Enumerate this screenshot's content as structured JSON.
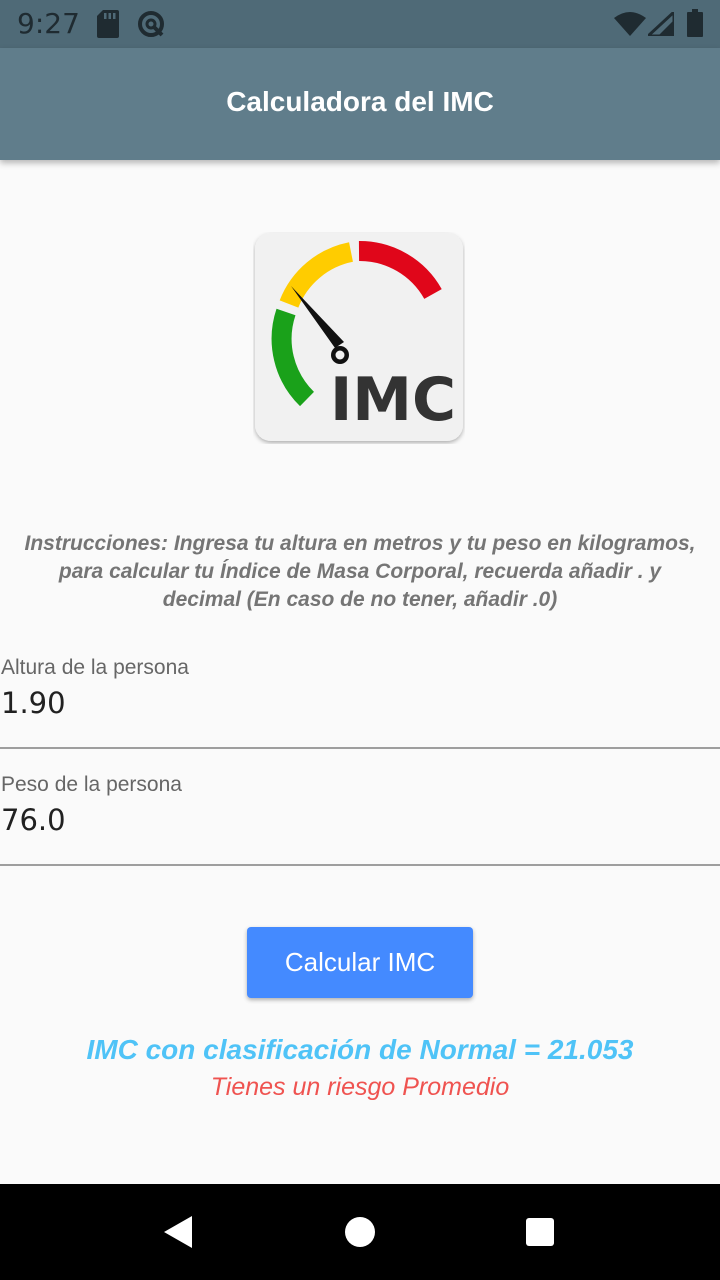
{
  "status_bar": {
    "time": "9:27",
    "icons": [
      "sd-card-icon",
      "sync-icon",
      "wifi-icon",
      "signal-icon",
      "battery-icon"
    ]
  },
  "app_bar": {
    "title": "Calculadora del IMC",
    "color": "#607d8b"
  },
  "logo": {
    "text": "IMC",
    "gauge_colors": [
      "#1aa11a",
      "#ffcc00",
      "#e0061a"
    ]
  },
  "instructions": "Instrucciones: Ingresa tu altura en metros y tu peso en kilogramos, para calcular tu Índice de Masa Corporal, recuerda añadir . y decimal (En caso de no tener, añadir .0)",
  "form": {
    "height": {
      "label": "Altura de la persona",
      "value": "1.90"
    },
    "weight": {
      "label": "Peso de la persona",
      "value": "76.0"
    }
  },
  "button": {
    "label": "Calcular IMC",
    "color": "#448aff"
  },
  "result": {
    "text": "IMC con clasificación de Normal = 21.053",
    "risk": "Tienes un riesgo Promedio",
    "text_color": "#4fc3f7",
    "risk_color": "#ef5350"
  },
  "nav_bar": {
    "icons": [
      "back-icon",
      "home-icon",
      "recents-icon"
    ]
  }
}
